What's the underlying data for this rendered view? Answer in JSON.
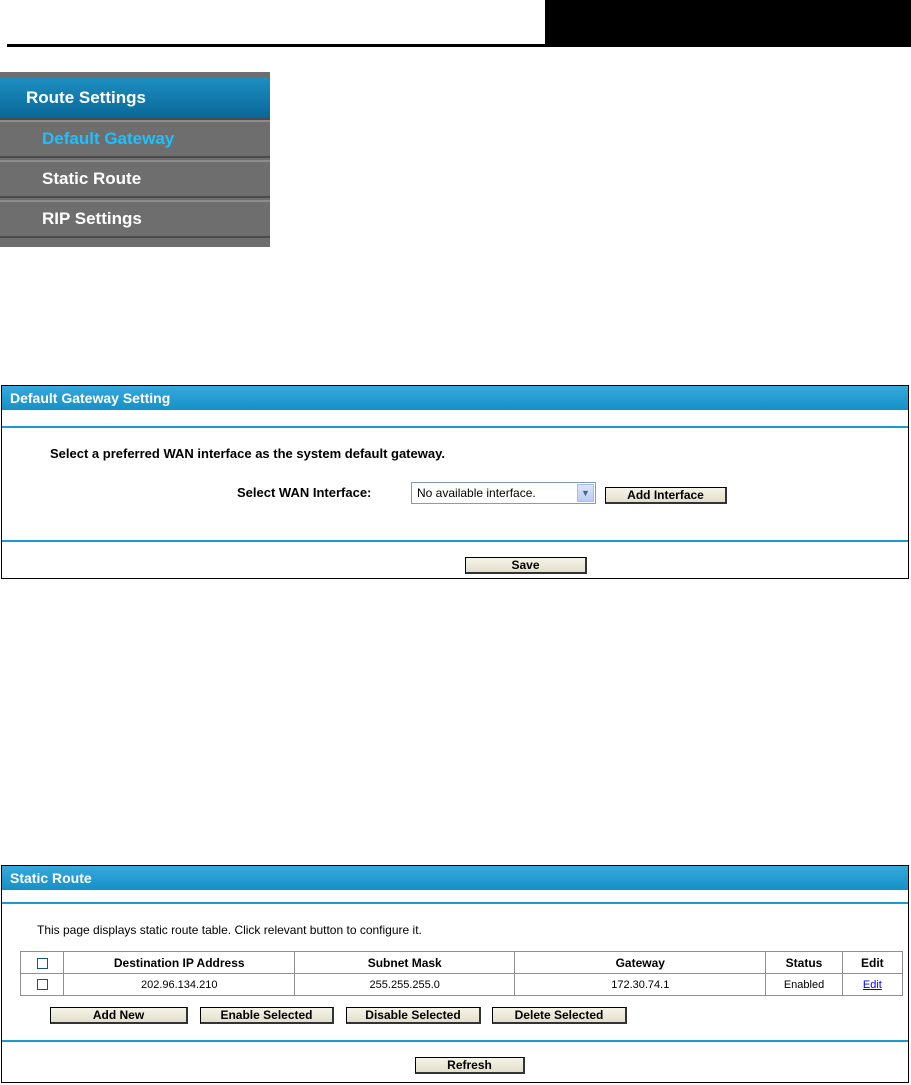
{
  "menu": {
    "header": "Route Settings",
    "items": [
      {
        "label": "Default Gateway",
        "active": true
      },
      {
        "label": "Static Route",
        "active": false
      },
      {
        "label": "RIP Settings",
        "active": false
      }
    ]
  },
  "gateway_panel": {
    "title": "Default Gateway Setting",
    "description": "Select a preferred WAN interface as the system default gateway.",
    "select_label": "Select WAN Interface:",
    "select_value": "No available interface.",
    "add_interface_label": "Add Interface",
    "save_label": "Save"
  },
  "static_route_panel": {
    "title": "Static Route",
    "description": "This page displays static route table. Click relevant button to configure it.",
    "columns": [
      "Destination IP Address",
      "Subnet Mask",
      "Gateway",
      "Status",
      "Edit"
    ],
    "rows": [
      {
        "destination": "202.96.134.210",
        "mask": "255.255.255.0",
        "gateway": "172.30.74.1",
        "status": "Enabled",
        "edit": "Edit"
      }
    ],
    "buttons": {
      "add_new": "Add New",
      "enable_selected": "Enable Selected",
      "disable_selected": "Disable Selected",
      "delete_selected": "Delete Selected",
      "refresh": "Refresh"
    }
  },
  "colors": {
    "accent": "#1590c8",
    "menu_bg": "#6e6e6e",
    "active_item": "#1ec0ff"
  }
}
